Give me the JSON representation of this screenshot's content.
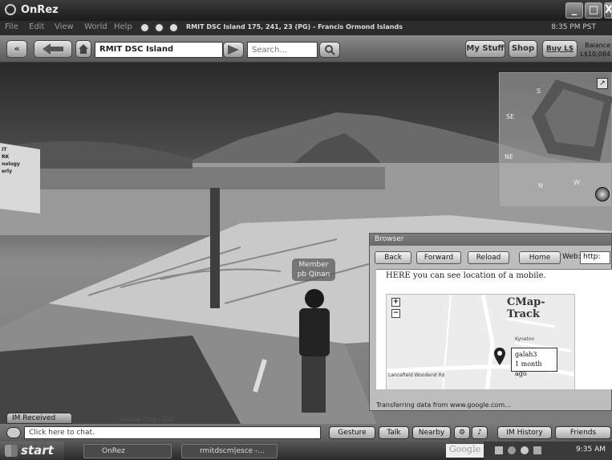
{
  "window": {
    "title": "OnRez",
    "minimize": "_",
    "maximize": "□",
    "close": "X"
  },
  "menu": {
    "items": [
      "File",
      "Edit",
      "View",
      "World",
      "Help"
    ],
    "location": "RMIT DSC Island 175, 241, 23 (PG) - Francis Ormond Islands",
    "clock": "8:35 PM PST"
  },
  "nav": {
    "back": "«",
    "address": "RMIT DSC Island",
    "search_placeholder": "Search...",
    "my_stuff": "My Stuff",
    "shop": "Shop",
    "buy": "Buy L$",
    "balance_label": "Balance",
    "balance_value": "L$10,084"
  },
  "scene": {
    "sign_text": "IT\nRK\nnology\nerly",
    "avatar_tag_line1": "Member",
    "avatar_tag_line2": "pb Qinan",
    "virtual_text": "Virtual Dog (1st)"
  },
  "minimap": {
    "labels": [
      "S",
      "SE",
      "NE",
      "W",
      "N"
    ]
  },
  "browser": {
    "title": "Browser",
    "back": "Back",
    "forward": "Forward",
    "reload": "Reload",
    "home": "Home",
    "web_label": "Web:",
    "url": "http:",
    "message": "HERE you can see location of a mobile.",
    "map_brand": "CMap-Track",
    "popup_name": "galah3",
    "popup_time": "1 month ago",
    "road1": "Lancefield Woodend Rd",
    "road2": "Kyneton",
    "status": "Transferring data from www.google.com..."
  },
  "bottom": {
    "im_received": "IM Received",
    "chat_placeholder": "Click here to chat.",
    "gesture": "Gesture",
    "talk": "Talk",
    "nearby": "Nearby",
    "im_history": "IM History",
    "friends": "Friends"
  },
  "taskbar": {
    "start": "start",
    "tasks": [
      "OnRez",
      "rmitdscm|esce -..."
    ],
    "google": "Google",
    "clock": "9:35 AM"
  }
}
